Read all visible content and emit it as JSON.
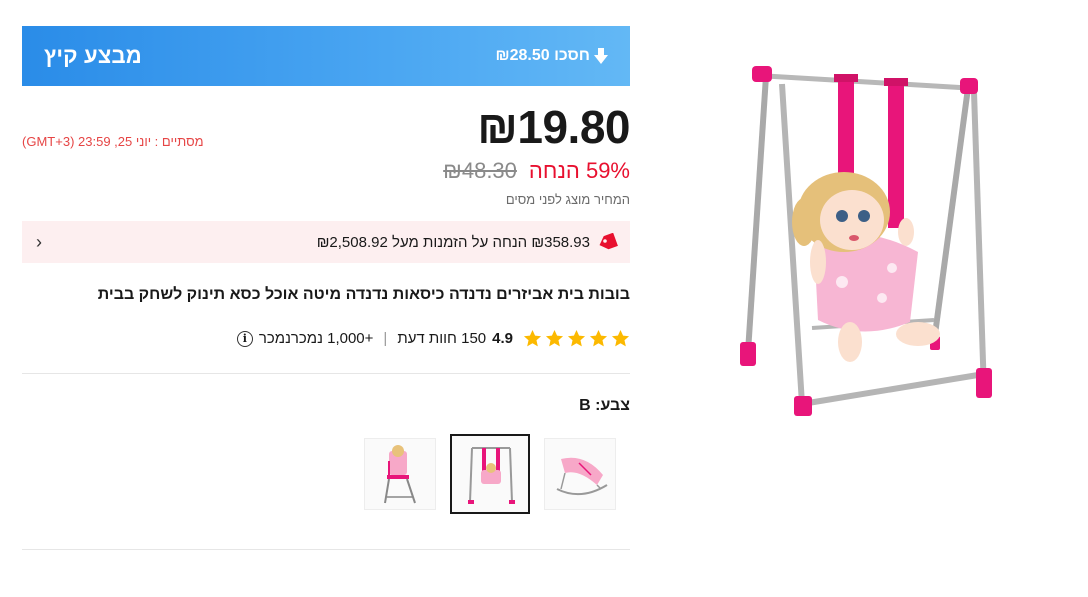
{
  "banner": {
    "title": "מבצע קיץ",
    "savings": "₪28.50 חסכו",
    "icon": "down-arrow-icon"
  },
  "price": {
    "current": "₪19.80",
    "original": "₪48.30",
    "discount": "59% הנחה",
    "tax_note": "המחיר מוצג לפני מסים",
    "countdown": "מסתיים : יוני 25, 23:59 (GMT+3)"
  },
  "coupon": {
    "text": "₪358.93 הנחה על הזמנות מעל ₪2,508.92",
    "icon": "tag-icon",
    "chevron": "›"
  },
  "product": {
    "title": "בובות בית אביזרים נדנדה כיסאות נדנדה מיטה אוכל כסא תינוק לשחק בבית"
  },
  "rating": {
    "value": "4.9",
    "stars": 5,
    "reviews": "150 חוות דעת",
    "sold": "+1,000  נמכרנמכר",
    "separator": "|"
  },
  "variant": {
    "label": "צבע: B",
    "options": [
      "high-chair",
      "swing",
      "bouncer"
    ],
    "selected": "swing"
  },
  "colors": {
    "banner": "#2a8ce8",
    "accent_red": "#e8102f",
    "countdown_red": "#e64545",
    "coupon_bg": "#fdeff0",
    "star": "#fcb900",
    "product_pink": "#e8157a"
  }
}
